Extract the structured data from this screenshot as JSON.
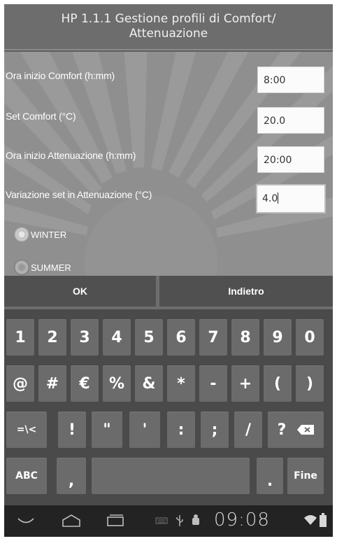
{
  "title": "HP 1.1.1 Gestione profili di Comfort/ Attenuazione",
  "form": {
    "fields": [
      {
        "label": "Ora inizio Comfort (h:mm)",
        "value": "8:00"
      },
      {
        "label": "Set Comfort (°C)",
        "value": "20.0"
      },
      {
        "label": "Ora inizio Attenuazione (h:mm)",
        "value": "20:00"
      },
      {
        "label": "Variazione set in Attenuazione (°C)",
        "value": "4.0"
      }
    ],
    "radios": [
      {
        "label": "WINTER",
        "selected": true
      },
      {
        "label": "SUMMER",
        "selected": false
      }
    ]
  },
  "buttons": {
    "ok": "OK",
    "back": "Indietro"
  },
  "keyboard": {
    "row1": [
      "1",
      "2",
      "3",
      "4",
      "5",
      "6",
      "7",
      "8",
      "9",
      "0"
    ],
    "row2": [
      "@",
      "#",
      "€",
      "%",
      "&",
      "*",
      "-",
      "+",
      "(",
      ")"
    ],
    "row3": [
      "=\\<",
      "!",
      "\"",
      "'",
      ":",
      ";",
      "/",
      "?"
    ],
    "row3_delete_icon": "backspace-icon",
    "row4": {
      "abc": "ABC",
      "comma": ",",
      "period": ".",
      "done": "Fine"
    }
  },
  "statusbar": {
    "time": "09:08",
    "icons": [
      "back-icon",
      "home-icon",
      "recent-apps-icon",
      "keyboard-icon",
      "usb-icon",
      "android-debug-icon",
      "wifi-icon",
      "battery-icon"
    ]
  }
}
